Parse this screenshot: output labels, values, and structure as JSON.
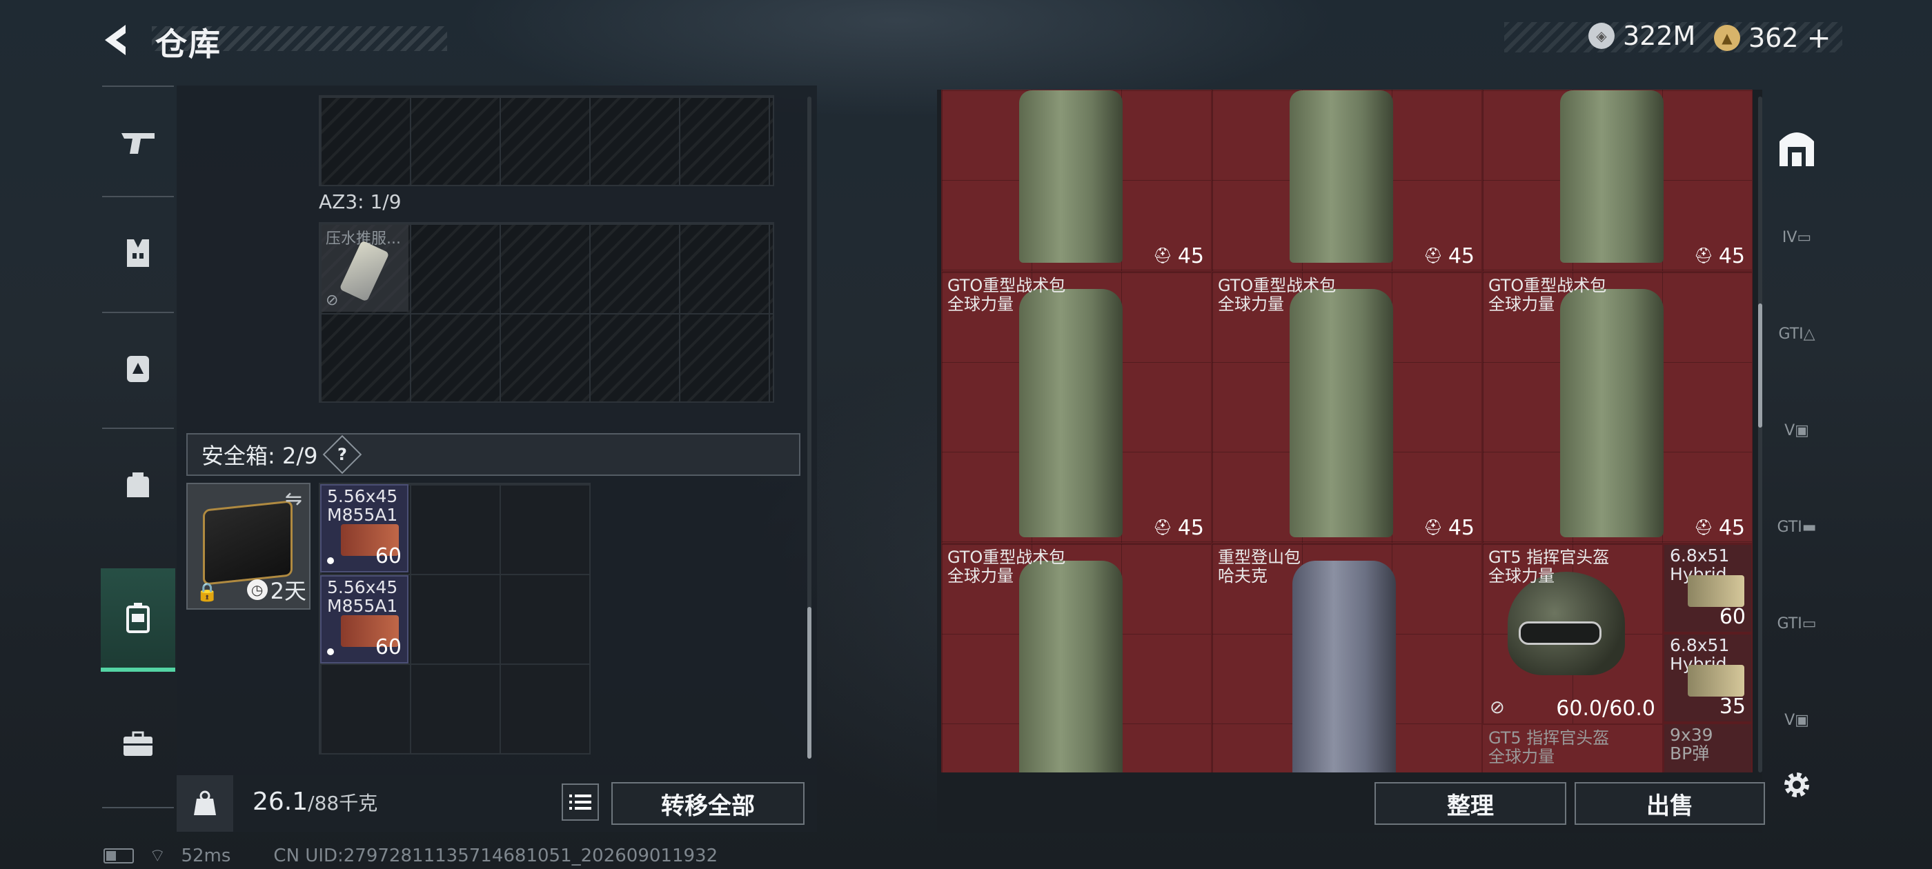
{
  "header": {
    "title": "仓库"
  },
  "currency": {
    "silver": "322M",
    "gold": "362",
    "plus": "+"
  },
  "left": {
    "az3_label": "AZ3: 1/9",
    "item_compression": "压水推服...",
    "safe_label": "安全箱: 2/9",
    "help": "?",
    "case_time": "2天",
    "ammo": [
      {
        "name": "5.56x45\nM855A1",
        "count": "60"
      },
      {
        "name": "5.56x45\nM855A1",
        "count": "60"
      }
    ],
    "weight_value": "26.1",
    "weight_unit": "/88千克",
    "transfer_all": "转移全部"
  },
  "right": {
    "items": [
      {
        "name": "",
        "count": "45"
      },
      {
        "name": "",
        "count": "45"
      },
      {
        "name": "",
        "count": "45"
      },
      {
        "name": "GTO重型战术包\n全球力量",
        "count": "45"
      },
      {
        "name": "GTO重型战术包\n全球力量",
        "count": "45"
      },
      {
        "name": "GTO重型战术包\n全球力量",
        "count": "45"
      },
      {
        "name": "GTO重型战术包\n全球力量",
        "count": ""
      },
      {
        "name": "重型登山包\n哈夫克",
        "count": ""
      }
    ],
    "helmet": {
      "name": "GT5 指挥官头盔\n全球力量",
      "durability": "60.0/60.0"
    },
    "helmet2": {
      "name": "GT5 指挥官头盔\n全球力量"
    },
    "ammo": [
      {
        "name": "6.8x51\nHybrid",
        "count": "60"
      },
      {
        "name": "6.8x51\nHybrid",
        "count": "35"
      },
      {
        "name": "9x39\nBP弹",
        "count": ""
      }
    ],
    "sort": "整理",
    "sell": "出售"
  },
  "footer": {
    "ping": "52ms",
    "uid": "CN UID:27972811135714681051_202609011932"
  },
  "colors": {
    "accent": "#54d4a4",
    "item_bg": "#6d2529",
    "ammo_bg": "#2c2e4a"
  }
}
